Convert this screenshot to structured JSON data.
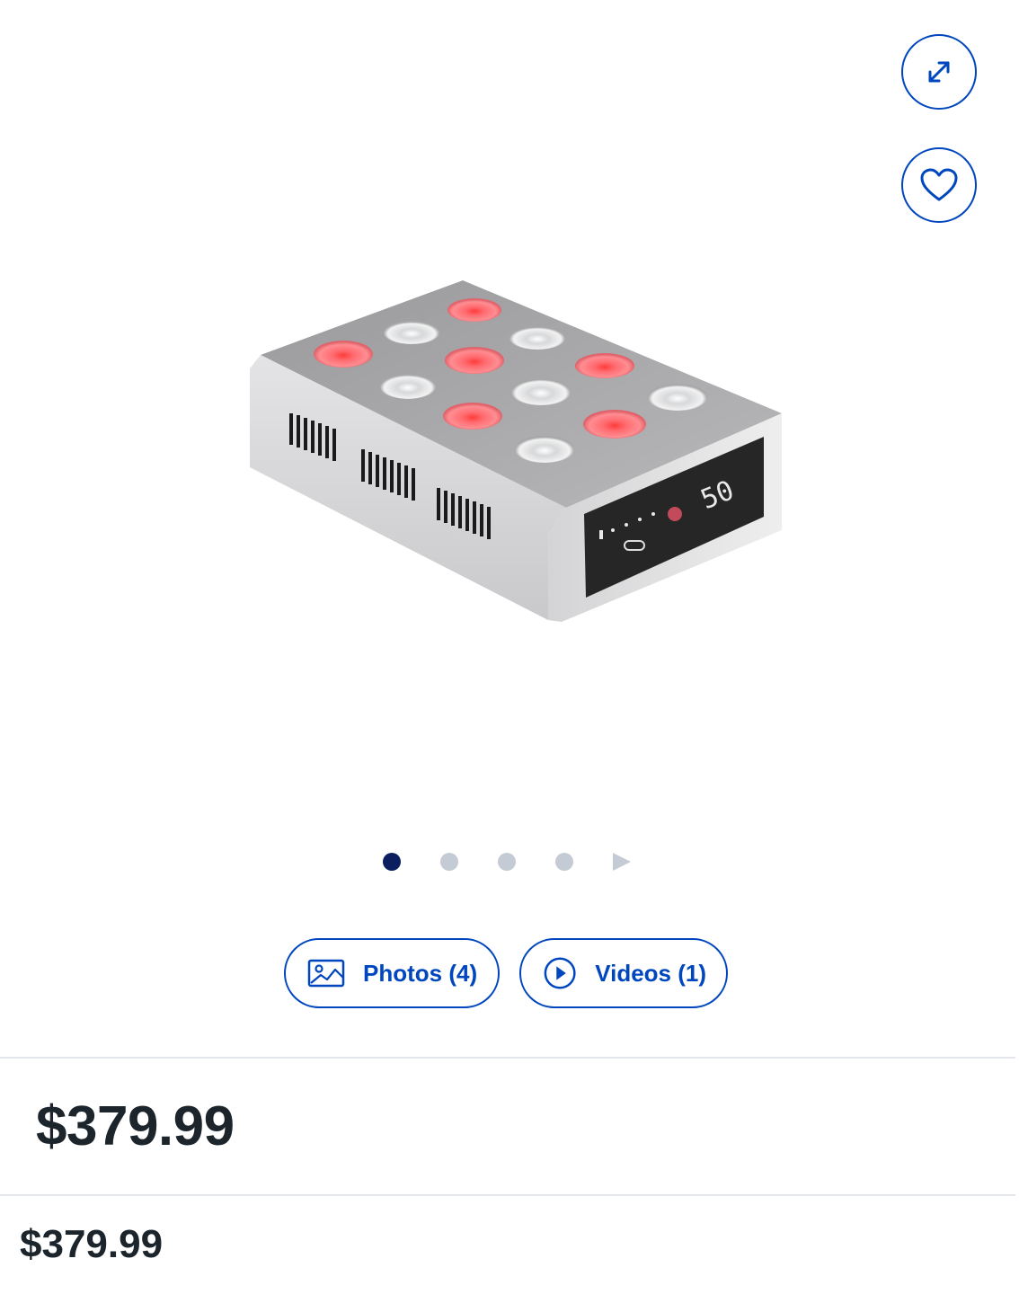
{
  "actions": {
    "expand_icon": "expand-arrows-icon",
    "favorite_icon": "heart-icon"
  },
  "carousel": {
    "total_dots": 4,
    "active_index": 0,
    "next_icon": "play-triangle-icon"
  },
  "media": {
    "photos_label": "Photos (4)",
    "videos_label": "Videos (1)",
    "photos_icon": "image-icon",
    "videos_icon": "play-circle-icon"
  },
  "product": {
    "display_reading": "50"
  },
  "pricing": {
    "main_price": "$379.99",
    "secondary_price": "$379.99"
  },
  "colors": {
    "accent": "#0046be",
    "active_dot": "#0a1e60",
    "inactive_dot": "#c5cbd5",
    "text": "#1d252c"
  }
}
